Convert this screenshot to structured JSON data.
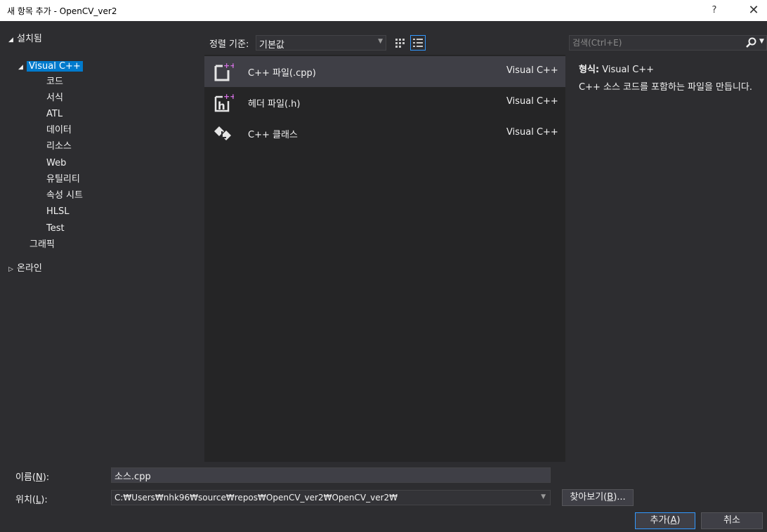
{
  "window": {
    "title": "새 항목 추가 - OpenCV_ver2",
    "help_glyph": "?",
    "close_glyph": "✕"
  },
  "tree": {
    "installed": "설치됨",
    "visual_cpp": "Visual C++",
    "children": [
      "코드",
      "서식",
      "ATL",
      "데이터",
      "리소스",
      "Web",
      "유틸리티",
      "속성 시트",
      "HLSL",
      "Test"
    ],
    "graphics": "그래픽",
    "online": "온라인"
  },
  "toolbar": {
    "sort_label": "정렬 기준:",
    "sort_value": "기본값"
  },
  "templates": [
    {
      "name": "C++ 파일(.cpp)",
      "language": "Visual C++",
      "icon": "cpp-file-icon",
      "selected": true
    },
    {
      "name": "헤더 파일(.h)",
      "language": "Visual C++",
      "icon": "header-file-icon",
      "selected": false
    },
    {
      "name": "C++ 클래스",
      "language": "Visual C++",
      "icon": "cpp-class-icon",
      "selected": false
    }
  ],
  "search": {
    "placeholder": "검색(Ctrl+E)"
  },
  "description": {
    "type_label": "형식:",
    "type_value": "Visual C++",
    "text": "C++ 소스 코드를 포함하는 파일을 만듭니다."
  },
  "form": {
    "name_label_pre": "이름(",
    "name_label_key": "N",
    "name_label_post": "):",
    "name_value": "소스.cpp",
    "location_label_pre": "위치(",
    "location_label_key": "L",
    "location_label_post": "):",
    "location_value": "C:₩Users₩nhk96₩source₩repos₩OpenCV_ver2₩OpenCV_ver2₩",
    "browse_pre": "찾아보기(",
    "browse_key": "B",
    "browse_post": ")...",
    "add_pre": "추가(",
    "add_key": "A",
    "add_post": ")",
    "cancel": "취소"
  },
  "colors": {
    "background": "#2d2d30",
    "accent": "#007acc",
    "selected_row": "#3f3f46",
    "plus": "#d16fe0"
  }
}
